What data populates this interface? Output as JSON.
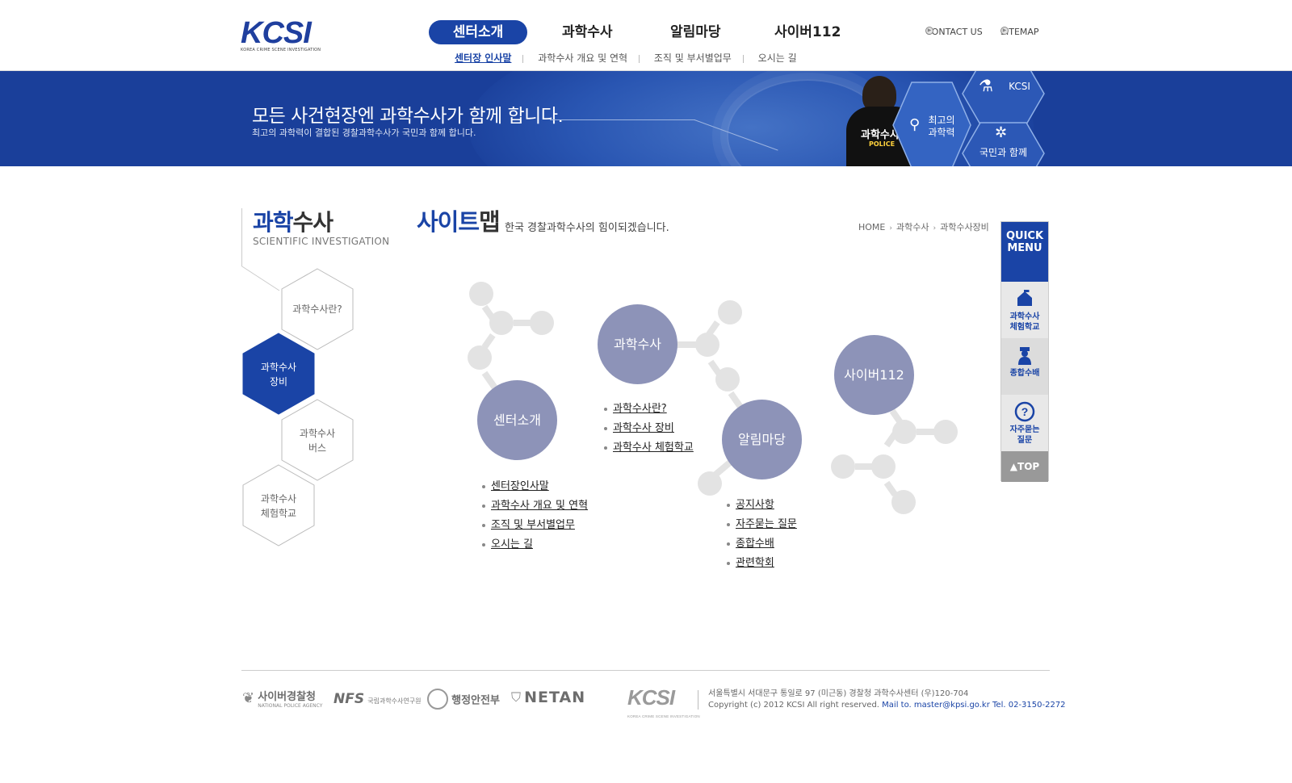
{
  "header": {
    "logo_text": "KCSI",
    "logo_sub": "KOREA CRIME SCENE INVESTIGATION",
    "gnb": [
      "센터소개",
      "과학수사",
      "알림마당",
      "사이버112"
    ],
    "util": [
      "CONTACT US",
      "SITEMAP"
    ],
    "lnb": [
      "센터장 인사말",
      "과학수사 개요 및 연혁",
      "조직 및 부서별업무",
      "오시는 길"
    ]
  },
  "banner": {
    "headline": "모든 사건현장엔 과학수사가 함께 합니다.",
    "subline": "최고의 과학력이 결합된 경찰과학수사가 국민과 함께 합니다.",
    "vest_text": "과학수사",
    "vest_sub": "POLICE",
    "hex1": "KCSI",
    "hex2": "최고의\n과학력",
    "hex3": "국민과 함께"
  },
  "left": {
    "title_a": "과학",
    "title_b": "수사",
    "subtitle": "SCIENTIFIC INVESTIGATION",
    "menu": [
      {
        "label": "과학수사란?"
      },
      {
        "label": "과학수사\n장비"
      },
      {
        "label": "과학수사\n버스"
      },
      {
        "label": "과학수사\n체험학교"
      }
    ]
  },
  "content": {
    "title_a": "사이트",
    "title_b": "맵",
    "desc": "한국 경찰과학수사의 힘이되겠습니다.",
    "breadcrumb": [
      "HOME",
      "과학수사",
      "과학수사장비"
    ],
    "sections": {
      "center": {
        "title": "센터소개",
        "links": [
          "센터장인사말",
          "과학수사 개요 및 연혁",
          "조직 및 부서별업무",
          "오시는 길"
        ]
      },
      "science": {
        "title": "과학수사",
        "links": [
          "과학수사란?",
          "과학수사 장비",
          "과학수사 체험학교"
        ]
      },
      "notice": {
        "title": "알림마당",
        "links": [
          "공지사항",
          "자주묻는 질문",
          "종합수배",
          "관련학회"
        ]
      },
      "cyber": {
        "title": "사이버112"
      }
    }
  },
  "quick": {
    "title": "QUICK\nMENU",
    "items": [
      "과학수사\n체험학교",
      "종합수배",
      "자주묻는\n질문"
    ],
    "top": "TOP"
  },
  "footer": {
    "orgs": [
      "사이버경찰청",
      "NATIONAL POLICE AGENCY",
      "NFS",
      "국립과학수사연구원",
      "행정안전부",
      "NETAN"
    ],
    "kcsi": "KCSI",
    "kcsi_sub": "KOREA CRIME SCENE INVESTIGATION",
    "address": "서울특별시 서대문구 통일로 97 (미근동) 경찰청 과학수사센터 (우)120-704",
    "copyright": "Copyright (c) 2012 KCSI All right reserved.",
    "contact": "Mail to. master@kpsi.go.kr Tel. 02-3150-2272"
  },
  "colors": {
    "brand": "#1a44a6",
    "circle": "#8d93b8",
    "dot": "#e3e3e3"
  }
}
